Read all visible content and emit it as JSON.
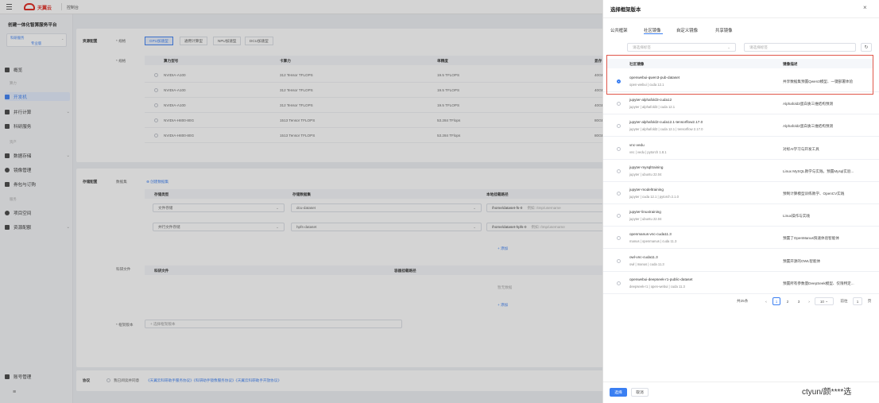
{
  "topbar": {
    "brand": "天翼云",
    "console": "控制台"
  },
  "sidebar": {
    "title": "创建一体化智算服务平台",
    "region_label": "科研服务",
    "region_value": "专业版",
    "groups": [
      "算力",
      "资产",
      "服务"
    ],
    "items": [
      {
        "label": "概览"
      },
      {
        "label": "开发机"
      },
      {
        "label": "并行计算"
      },
      {
        "label": "科研服务"
      },
      {
        "label": "数据存储"
      },
      {
        "label": "镜像管理"
      },
      {
        "label": "券包与订购"
      },
      {
        "label": "项目空间"
      },
      {
        "label": "资源配额"
      }
    ],
    "account": "账号管理"
  },
  "main": {
    "resource_section": "资源配置",
    "resource_type_label": "* 规格",
    "spec_label": "* 规格",
    "resource_tabs": [
      "GPU加速型",
      "通用计算型",
      "NPU加速型",
      "DCU加速型"
    ],
    "spec_headers": [
      "算力型号",
      "卡算力",
      "单精度",
      "显存"
    ],
    "spec_rows": [
      [
        "NVIDIA-A100",
        "312 Tensor TFLOPS",
        "19.5 TFLOPS",
        "40GB"
      ],
      [
        "NVIDIA-A100",
        "312 Tensor TFLOPS",
        "19.5 TFLOPS",
        "40GB"
      ],
      [
        "NVIDIA-A100",
        "312 Tensor TFLOPS",
        "19.5 TFLOPS",
        "40GB"
      ],
      [
        "NVIDIA-H800-80G",
        "1513 Tensor TFLOPS",
        "53.284 TFlops",
        "80GB"
      ],
      [
        "NVIDIA-H800-80G",
        "1513 Tensor TFLOPS",
        "53.284 TFlops",
        "80GB"
      ]
    ],
    "storage_section": "存储配置",
    "data_set_label": "数据集",
    "add_storage": "⊕ 创建数据集",
    "storage_headers": [
      "存储类型",
      "存储数据集",
      "本地挂载路径"
    ],
    "storage_rows": [
      [
        "文件存储",
        "dcu-dataset",
        "/home/dataset-fs-0",
        "例如: /tmp/username"
      ],
      [
        "并行文件存储",
        "hpfs-dataset",
        "/home/dataset-hpfs-0",
        "例如: /tmp/username"
      ]
    ],
    "add_link": "+ 添加",
    "code_label": "科研文件",
    "code_headers": [
      "科研文件",
      "容器挂载路径"
    ],
    "code_empty": "暂无数据",
    "code_add": "+ 添加",
    "image_label": "* 框架版本",
    "image_placeholder": "+ 选择框架版本",
    "agreement_section": "协议",
    "agreement_text": "我已阅读并同意",
    "agreement_links": "《天翼云科研助手服务协议》《科研助手镜像服务协议》《天翼云科研助手开放协议》"
  },
  "drawer": {
    "title": "选择框架版本",
    "close": "×",
    "tabs": [
      "公共框架",
      "社区镜像",
      "自定义镜像",
      "共享镜像"
    ],
    "active_tab": 1,
    "filter_placeholder": "请选择标签",
    "search_placeholder": "请选择标签",
    "headers": [
      "社区镜像",
      "镜像描述"
    ],
    "rows": [
      {
        "name": "openwebui-qwen3-pub-dataset",
        "tags": "open-webui | cuda 12.1",
        "desc": "共享数据集预置Qwen3模型、一键部署体验"
      },
      {
        "name": "jupyter-alphafold3-cuda12",
        "tags": "jupyter | alphafold3 | cuda 12.1",
        "desc": "Alphafold3蛋白质三维结构预测"
      },
      {
        "name": "jupyter-alphafold2-cuda12.1-tensorflow2.17.0",
        "tags": "jupyter | alphafold2 | cuda 12.1 | tensorflow 2.17.0",
        "desc": "Alphafold2蛋白质三维结构预测"
      },
      {
        "name": "vnc-vedu",
        "tags": "vnc | vedu | pytorch 1.8.1",
        "desc": "对标AI学习与开发工具"
      },
      {
        "name": "jupyter-mysqltraining",
        "tags": "jupyter | ubuntu 22.04",
        "desc": "Linux MySQL教学与实践，预置Mysql实验..."
      },
      {
        "name": "jupyter-modeltraining",
        "tags": "jupyter | cuda 12.1 | pytorch 2.1.0",
        "desc": "预制计算模型训练教学、OpenCV实践"
      },
      {
        "name": "jupyter-linuxtraining",
        "tags": "jupyter | ubuntu 22.04",
        "desc": "Linux操作与实践"
      },
      {
        "name": "openmanus-vnc-cuda11.3",
        "tags": "manus | openmanus | cuda 11.3",
        "desc": "预置了OpenManus快速体验智能体"
      },
      {
        "name": "owl-vnc-cuda11.3",
        "tags": "owl | manus | cuda 11.3",
        "desc": "预置开源的OWL智能体"
      },
      {
        "name": "openwebui-deepseek-r1-public-dataset",
        "tags": "deepseek-r1 | open-webui | cuda 11.3",
        "desc": "预置所有参数量DeepSeek模型、仅限特定..."
      }
    ],
    "selected_row": 0,
    "pagination": {
      "total": "共25条",
      "pages": [
        "1",
        "2",
        "3"
      ],
      "current": 1,
      "size": "10",
      "goto_label": "前往",
      "goto_value": "1",
      "goto_suffix": "页"
    },
    "confirm": "选择",
    "cancel": "取消"
  },
  "watermark": "ctyun/颜****选"
}
